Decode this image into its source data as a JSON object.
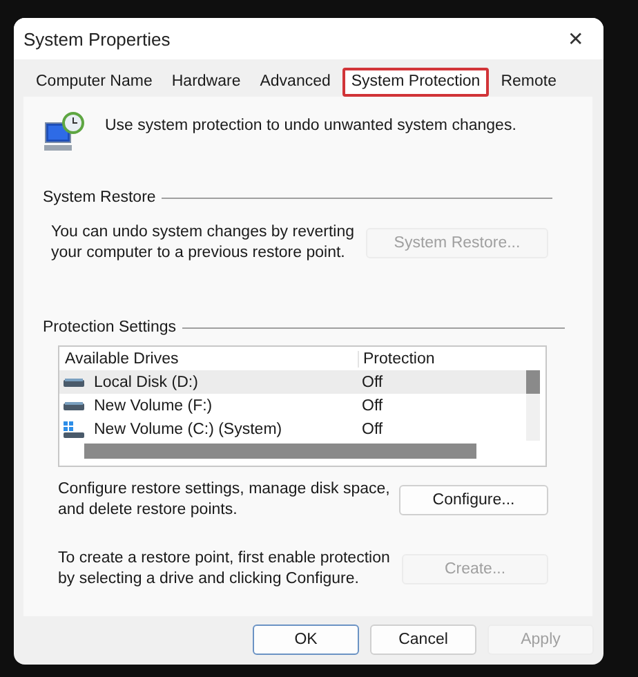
{
  "window": {
    "title": "System Properties",
    "close": "✕"
  },
  "tabs": [
    {
      "label": "Computer Name",
      "selected": false
    },
    {
      "label": "Hardware",
      "selected": false
    },
    {
      "label": "Advanced",
      "selected": false
    },
    {
      "label": "System Protection",
      "selected": true
    },
    {
      "label": "Remote",
      "selected": false
    }
  ],
  "intro": "Use system protection to undo unwanted system changes.",
  "system_restore": {
    "heading": "System Restore",
    "text": "You can undo system changes by reverting your computer to a previous restore point.",
    "button": {
      "label": "System Restore...",
      "disabled": true
    }
  },
  "protection_settings": {
    "heading": "Protection Settings",
    "columns": [
      "Available Drives",
      "Protection"
    ],
    "rows": [
      {
        "kind": "disk",
        "drive": "Local Disk (D:)",
        "protection": "Off",
        "selected": true
      },
      {
        "kind": "disk",
        "drive": "New Volume (F:)",
        "protection": "Off",
        "selected": false
      },
      {
        "kind": "system",
        "drive": "New Volume (C:) (System)",
        "protection": "Off",
        "selected": false
      }
    ],
    "configure_text": "Configure restore settings, manage disk space, and delete restore points.",
    "configure_button": {
      "label": "Configure...",
      "disabled": false
    },
    "create_text": "To create a restore point, first enable protection by selecting a drive and clicking Configure.",
    "create_button": {
      "label": "Create...",
      "disabled": true
    }
  },
  "buttons": [
    {
      "label": "OK",
      "disabled": false,
      "default": true
    },
    {
      "label": "Cancel",
      "disabled": false,
      "default": false
    },
    {
      "label": "Apply",
      "disabled": true,
      "default": false
    }
  ]
}
